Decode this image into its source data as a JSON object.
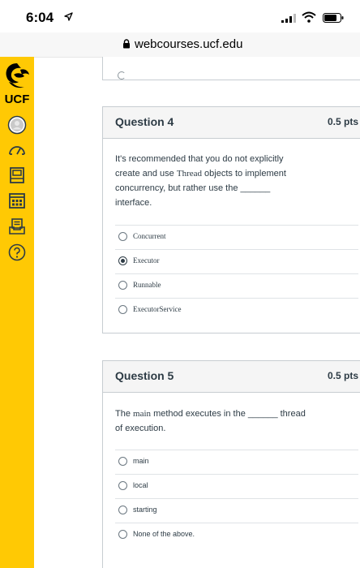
{
  "status_bar": {
    "time": "6:04"
  },
  "browser": {
    "url": "webcourses.ucf.edu"
  },
  "nav": {
    "brand": "UCF",
    "items": [
      "account-icon",
      "dashboard-icon",
      "courses-icon",
      "calendar-icon",
      "inbox-icon",
      "help-icon"
    ]
  },
  "questions": [
    {
      "name": "Question 4",
      "points": "0.5 pts",
      "text": {
        "l1": "It's recommended that you do not explicitly",
        "l2a": "create and use ",
        "l2code": "Thread",
        "l2b": " objects to implement",
        "l3": "concurrency, but rather use the ______",
        "l4": "interface."
      },
      "answers": [
        "Concurrent",
        "Executor",
        "Runnable",
        "ExecutorService"
      ],
      "selected": "Executor"
    },
    {
      "name": "Question 5",
      "points": "0.5 pts",
      "text": {
        "l1a": "The ",
        "l1code": "main",
        "l1b": " method executes in the ______ thread",
        "l2": "of execution."
      },
      "answers": [
        "main",
        "local",
        "starting",
        "None of the above."
      ],
      "selected": null
    }
  ],
  "colors": {
    "nav": "#ffc904",
    "text": "#2d3b45",
    "border": "#c7cdd1"
  }
}
